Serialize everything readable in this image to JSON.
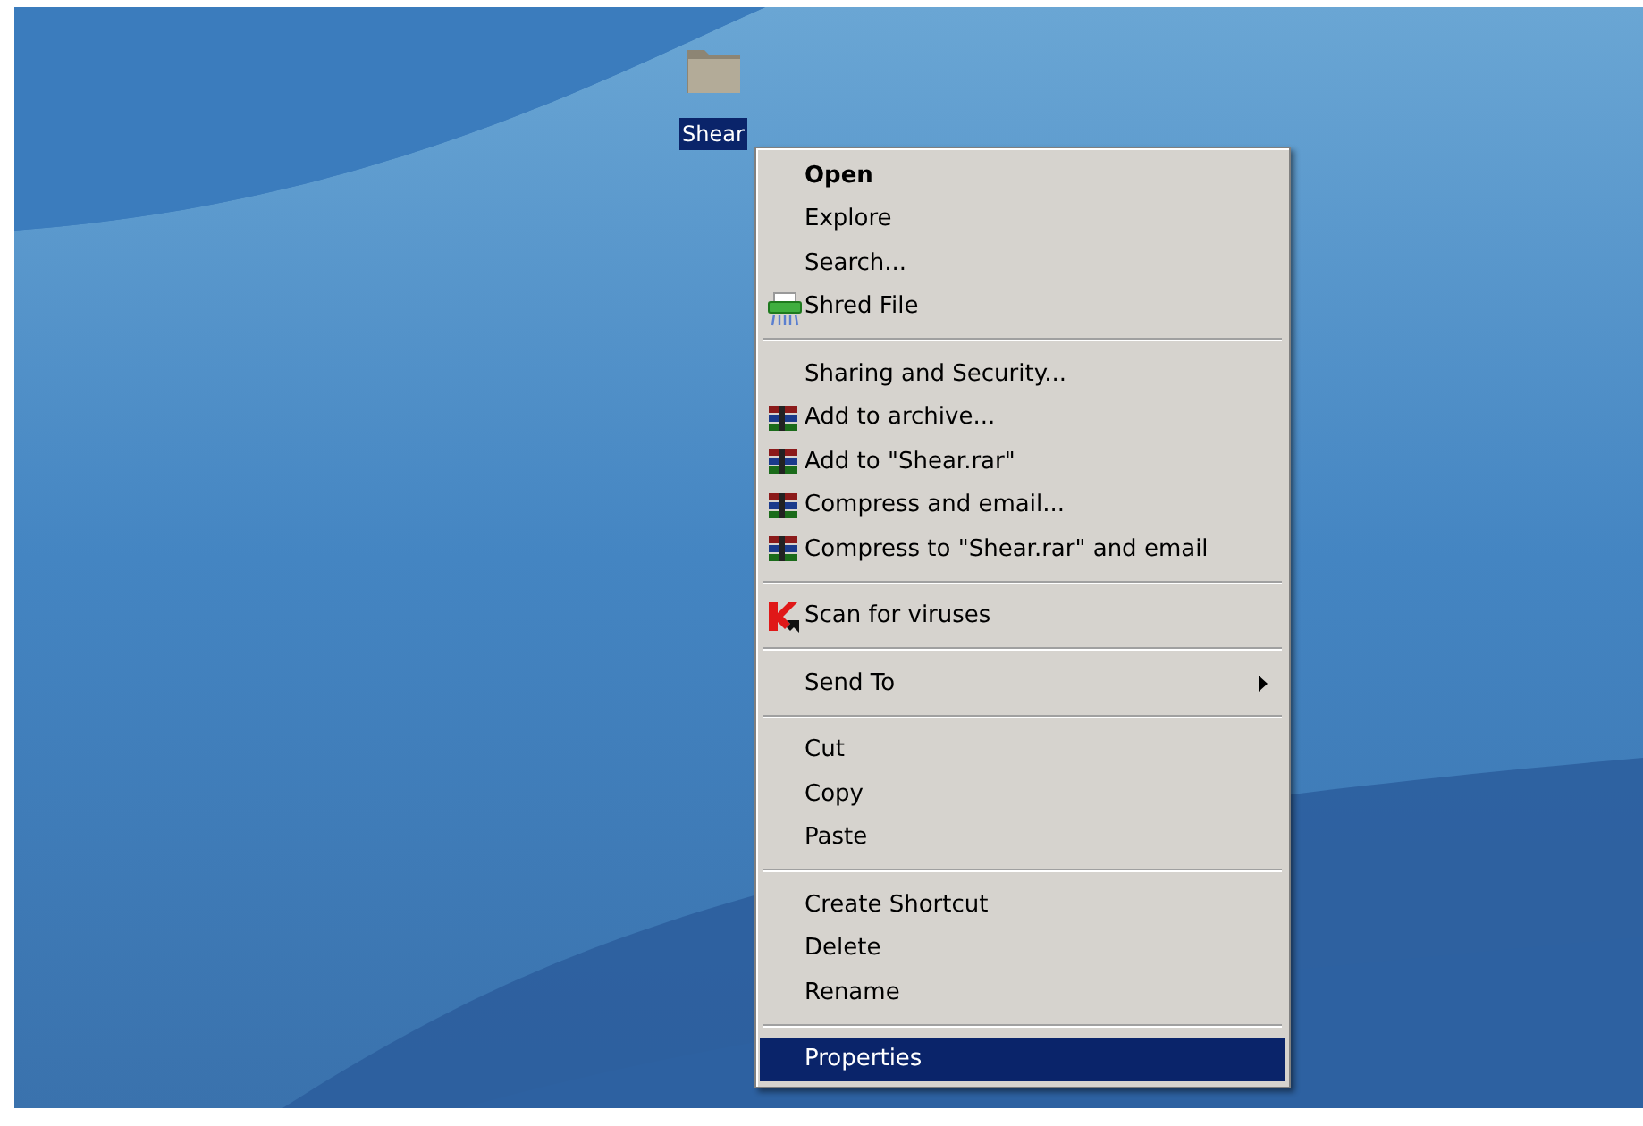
{
  "desktop_icon": {
    "label": "Shear",
    "selected": true
  },
  "context_menu": {
    "groups": [
      [
        {
          "label": "Open",
          "kind": "plain",
          "default": true,
          "selected": false
        },
        {
          "label": "Explore",
          "kind": "plain",
          "default": false,
          "selected": false
        },
        {
          "label": "Search...",
          "kind": "plain",
          "default": false,
          "selected": false
        },
        {
          "label": "Shred File",
          "kind": "shredder",
          "default": false,
          "selected": false
        }
      ],
      [
        {
          "label": "Sharing and Security...",
          "kind": "plain",
          "default": false,
          "selected": false
        },
        {
          "label": "Add to archive...",
          "kind": "archiver",
          "default": false,
          "selected": false
        },
        {
          "label": "Add to \"Shear.rar\"",
          "kind": "archiver",
          "default": false,
          "selected": false
        },
        {
          "label": "Compress and email...",
          "kind": "archiver",
          "default": false,
          "selected": false
        },
        {
          "label": "Compress to \"Shear.rar\" and email",
          "kind": "archiver",
          "default": false,
          "selected": false
        }
      ],
      [
        {
          "label": "Scan for viruses",
          "kind": "antivirus",
          "default": false,
          "selected": false
        }
      ],
      [
        {
          "label": "Send To",
          "kind": "submenu",
          "default": false,
          "selected": false
        }
      ],
      [
        {
          "label": "Cut",
          "kind": "plain",
          "default": false,
          "selected": false
        },
        {
          "label": "Copy",
          "kind": "plain",
          "default": false,
          "selected": false
        },
        {
          "label": "Paste",
          "kind": "plain",
          "default": false,
          "selected": false
        }
      ],
      [
        {
          "label": "Create Shortcut",
          "kind": "plain",
          "default": false,
          "selected": false
        },
        {
          "label": "Delete",
          "kind": "plain",
          "default": false,
          "selected": false
        },
        {
          "label": "Rename",
          "kind": "plain",
          "default": false,
          "selected": false
        }
      ],
      [
        {
          "label": "Properties",
          "kind": "plain",
          "default": false,
          "selected": true
        }
      ]
    ]
  }
}
